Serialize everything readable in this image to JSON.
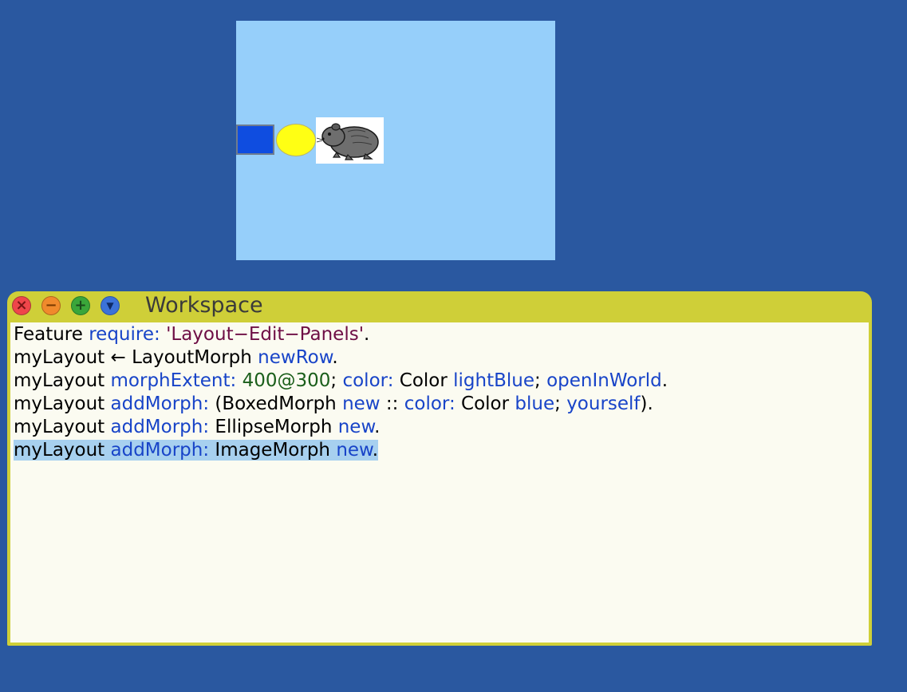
{
  "workspace": {
    "title": "Workspace",
    "buttons": {
      "close": "×",
      "collapse": "−",
      "expand": "+",
      "menu": "▼"
    }
  },
  "code_lines": [
    [
      {
        "t": "Feature ",
        "c": "plain"
      },
      {
        "t": "require: ",
        "c": "kw"
      },
      {
        "t": "'Layout−Edit−Panels'",
        "c": "str"
      },
      {
        "t": ".",
        "c": "plain"
      }
    ],
    [
      {
        "t": "myLayout ← LayoutMorph ",
        "c": "plain"
      },
      {
        "t": "newRow",
        "c": "kw"
      },
      {
        "t": ".",
        "c": "plain"
      }
    ],
    [
      {
        "t": "myLayout ",
        "c": "plain"
      },
      {
        "t": "morphExtent: ",
        "c": "kw"
      },
      {
        "t": "400@300",
        "c": "num"
      },
      {
        "t": "; ",
        "c": "plain"
      },
      {
        "t": "color: ",
        "c": "kw"
      },
      {
        "t": "Color ",
        "c": "plain"
      },
      {
        "t": "lightBlue",
        "c": "kw"
      },
      {
        "t": "; ",
        "c": "plain"
      },
      {
        "t": "openInWorld",
        "c": "kw"
      },
      {
        "t": ".",
        "c": "plain"
      }
    ],
    [
      {
        "t": "myLayout ",
        "c": "plain"
      },
      {
        "t": "addMorph: ",
        "c": "kw"
      },
      {
        "t": "(BoxedMorph ",
        "c": "plain"
      },
      {
        "t": "new ",
        "c": "kw"
      },
      {
        "t": ":: ",
        "c": "plain"
      },
      {
        "t": "color: ",
        "c": "kw"
      },
      {
        "t": "Color ",
        "c": "plain"
      },
      {
        "t": "blue",
        "c": "kw"
      },
      {
        "t": "; ",
        "c": "plain"
      },
      {
        "t": "yourself",
        "c": "kw"
      },
      {
        "t": ").",
        "c": "plain"
      }
    ],
    [
      {
        "t": "myLayout ",
        "c": "plain"
      },
      {
        "t": "addMorph: ",
        "c": "kw"
      },
      {
        "t": "EllipseMorph ",
        "c": "plain"
      },
      {
        "t": "new",
        "c": "kw"
      },
      {
        "t": ".",
        "c": "plain"
      }
    ],
    [
      {
        "t": "myLayout ",
        "c": "plain"
      },
      {
        "t": "addMorph: ",
        "c": "kw"
      },
      {
        "t": "ImageMorph ",
        "c": "plain"
      },
      {
        "t": "new",
        "c": "kw"
      },
      {
        "t": ".",
        "c": "plain"
      }
    ]
  ],
  "selected_line_index": 5,
  "colors": {
    "desktop": "#2a58a0",
    "layout_morph": "#96cffa",
    "boxed_morph": "#0f4de0",
    "ellipse_morph": "#ffff14",
    "window_frame": "#cfcf38",
    "editor_background": "#fbfbf1",
    "selection": "#a7d0ef",
    "keyword": "#1844c8",
    "string": "#6e0e45",
    "number": "#1a5e1a"
  },
  "morphs": {
    "image_icon": "guinea-pig-icon"
  }
}
